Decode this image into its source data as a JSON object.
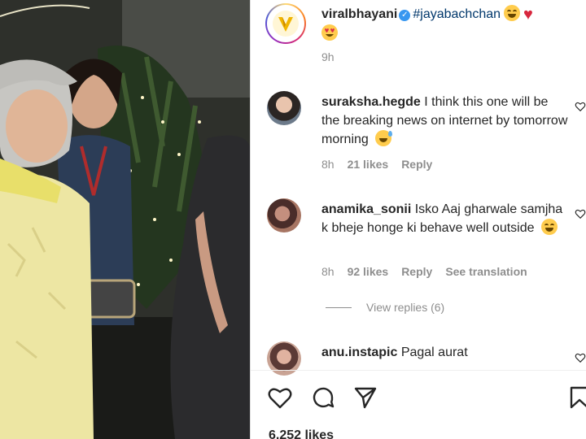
{
  "post": {
    "username": "viralbhayani",
    "verified_icon": "verified-badge-icon",
    "hashtag": "#jayabachchan",
    "time": "9h",
    "likes": "6,252 likes"
  },
  "comments": [
    {
      "username": "suraksha.hegde",
      "text": "I think this one will be the breaking news on internet by tomorrow morning",
      "emoji": "grinning-sweat-emoji",
      "time": "8h",
      "likes": "21 likes",
      "reply": "Reply"
    },
    {
      "username": "anamika_sonii",
      "text": "Isko Aaj gharwale samjha k bheje honge ki behave well outside",
      "emoji": "tears-of-joy-emoji",
      "time": "8h",
      "likes": "92 likes",
      "reply": "Reply",
      "translate": "See translation",
      "view_replies": "View replies (6)"
    },
    {
      "username": "anu.instapic",
      "text": "Pagal aurat"
    }
  ],
  "icons": {
    "like": "heart-icon",
    "comment": "comment-icon",
    "share": "share-icon",
    "save": "bookmark-icon"
  },
  "colors": {
    "text": "#262626",
    "muted": "#8e8e8e",
    "link": "#00376b",
    "verified": "#3897f0"
  }
}
